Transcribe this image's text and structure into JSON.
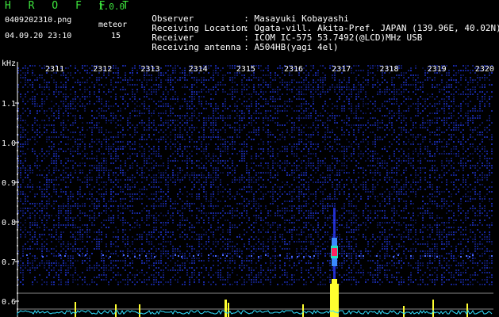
{
  "app": {
    "name": "H R O F F T",
    "version": "1.0.0"
  },
  "file": {
    "name": "0409202310.png",
    "datetime": "04.09.20 23:10"
  },
  "meteor": {
    "label": "meteor",
    "count": "15"
  },
  "info": [
    {
      "label": "Observer",
      "sep": ":",
      "value": "Masayuki Kobayashi"
    },
    {
      "label": "Receiving Location",
      "sep": ":",
      "value": "Ogata-vill. Akita-Pref. JAPAN (139.96E, 40.02N)"
    },
    {
      "label": "Receiver",
      "sep": ":",
      "value": "ICOM IC-575 53.7492(@LCD)MHz USB"
    },
    {
      "label": "Receiving antenna",
      "sep": ":",
      "value": "A504HB(yagi 4el)"
    }
  ],
  "spectrogram": {
    "y_unit": "kHz",
    "y_ticks": [
      "1.1",
      "1.0",
      "0.9",
      "0.8",
      "0.7",
      "0.6"
    ],
    "x_ticks": [
      "2311",
      "2312",
      "2313",
      "2314",
      "2315",
      "2316",
      "2317",
      "2318",
      "2319",
      "2320"
    ],
    "colors": {
      "background": "#000000",
      "noise": "#1a2a9a",
      "axis": "#ffffff",
      "label_text": "#ffffff",
      "hot": "#ff2060",
      "activity": "#ffff30"
    }
  }
}
